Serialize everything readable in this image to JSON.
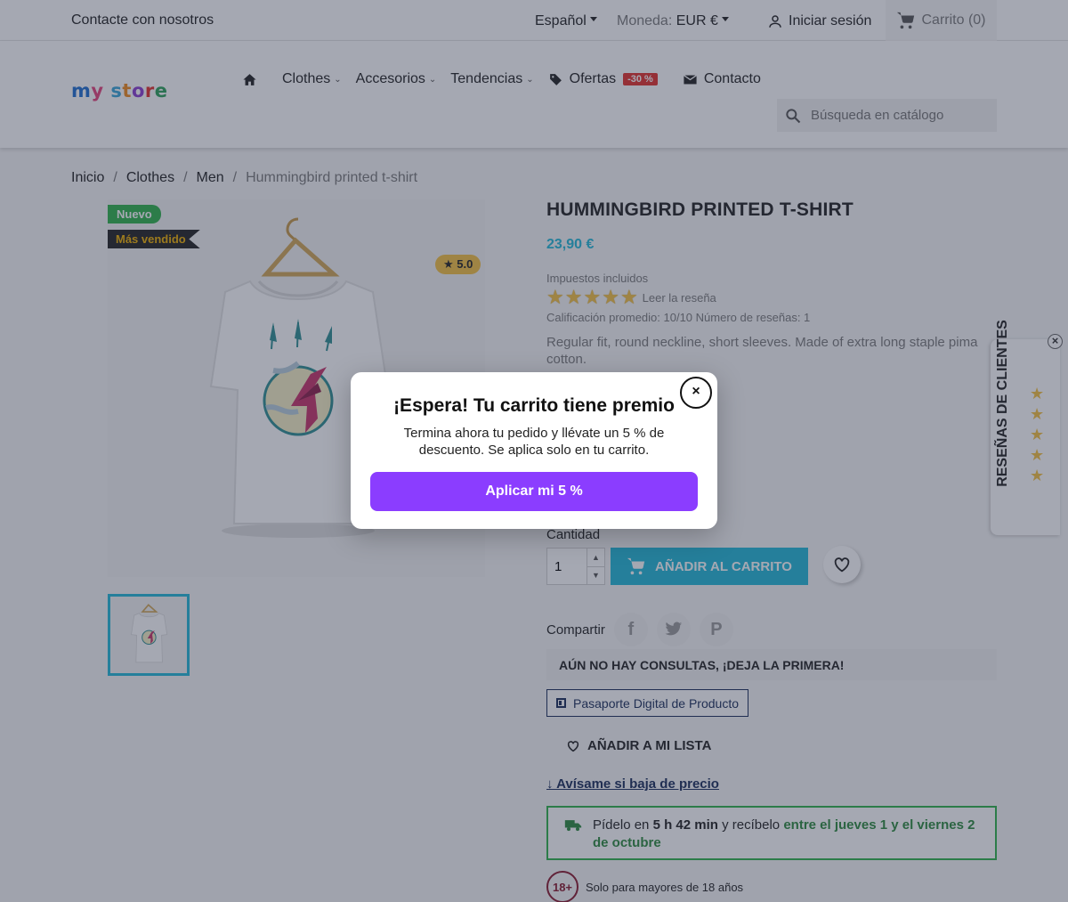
{
  "topbar": {
    "contact": "Contacte con nosotros",
    "language": "Español",
    "currency_label": "Moneda:",
    "currency_value": "EUR €",
    "login": "Iniciar sesión",
    "cart": "Carrito (0)"
  },
  "header": {
    "logo": {
      "part1": "my",
      "part2": "store"
    },
    "nav": [
      {
        "label": "Clothes"
      },
      {
        "label": "Accesorios"
      },
      {
        "label": "Tendencias"
      },
      {
        "label": "Ofertas",
        "badge": "-30 %"
      },
      {
        "label": "Contacto"
      }
    ],
    "search_placeholder": "Búsqueda en catálogo"
  },
  "breadcrumb": [
    "Inicio",
    "Clothes",
    "Men",
    "Hummingbird printed t-shirt"
  ],
  "product": {
    "flag_new": "Nuevo",
    "flag_best": "Más vendido",
    "rating_badge": "★ 5.0",
    "title": "HUMMINGBIRD PRINTED T-SHIRT",
    "price": "23,90 €",
    "tax": "Impuestos incluidos",
    "rating_stars": 5,
    "read_review": "Leer la reseña",
    "avg_rating": "Calificación promedio: 10/10 Número de reseñas: 1",
    "description": "Regular fit, round neckline, short sleeves. Made of extra long staple pima cotton.",
    "quantity_label": "Cantidad",
    "quantity_value": "1",
    "add_to_cart": "AÑADIR AL CARRITO",
    "share_label": "Compartir",
    "qa_bar": "AÚN NO HAY CONSULTAS, ¡DEJA LA PRIMERA!",
    "passport": "Pasaporte Digital de Producto",
    "wishlist": "AÑADIR A MI LISTA",
    "price_alert": "↓ Avísame si baja de precio",
    "delivery": {
      "prefix": "Pídelo en",
      "time": "5 h 42 min",
      "middle": "y recíbelo",
      "range": "entre el jueves 1 y el viernes 2 de octubre"
    },
    "age_badge": "18+",
    "age_text": "Solo para mayores de 18 años"
  },
  "reviews_tab": {
    "label": "RESEÑAS DE CLIENTES"
  },
  "modal": {
    "close": "×",
    "title": "¡Espera! Tu carrito tiene premio",
    "text": "Termina ahora tu pedido y llévate un 5 % de descuento. Se aplica solo en tu carrito.",
    "cta": "Aplicar mi 5 %"
  },
  "colors": {
    "accent": "#24b9d7",
    "cta_purple": "#8b3dff",
    "sale_red": "#e4312b",
    "new_green": "#2fb34a",
    "star": "#f4c242"
  }
}
